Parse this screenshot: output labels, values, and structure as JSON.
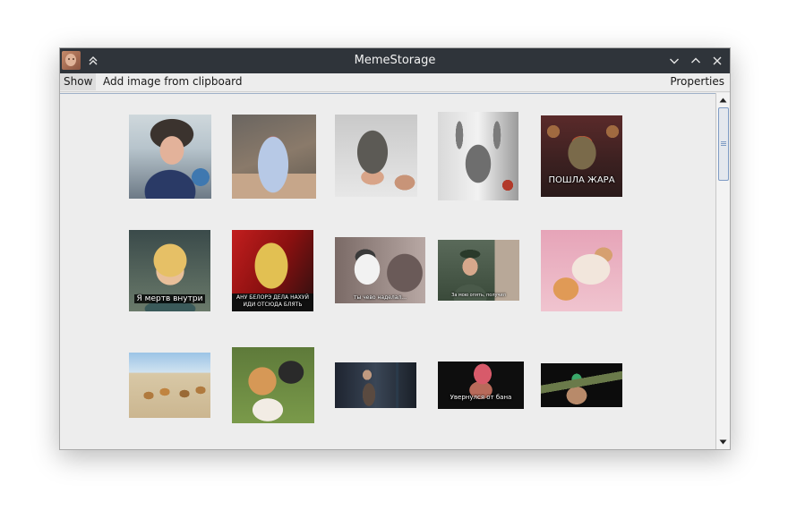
{
  "window": {
    "title": "MemeStorage",
    "icons": {
      "app": "app-avatar-icon",
      "keep_above": "double-chevron-up-icon",
      "minimize": "chevron-down-icon",
      "maximize": "chevron-up-icon",
      "close": "close-icon"
    }
  },
  "menu": {
    "show": "Show",
    "add_from_clipboard": "Add image from clipboard",
    "properties": "Properties"
  },
  "memes": {
    "row1": [
      {
        "name": "meme-boy-globe"
      },
      {
        "name": "meme-shark-costume"
      },
      {
        "name": "meme-wet-cat"
      },
      {
        "name": "meme-cat-arms-up"
      },
      {
        "name": "meme-armored-warrior",
        "caption": "ПОШЛА ЖАРА"
      }
    ],
    "row2": [
      {
        "name": "meme-blond-elf",
        "caption": "Я мертв внутри"
      },
      {
        "name": "meme-blood-elf",
        "caption_line1": "АНУ БЕЛОРЭ ДЕЛА НАХУЙ",
        "caption_line2": "ИДИ ОТСЮДА БЛЯТЬ"
      },
      {
        "name": "meme-cat-hedgehog",
        "caption": "ты чево наделал..."
      },
      {
        "name": "meme-officer",
        "caption": "За мою опять, получил"
      },
      {
        "name": "meme-cat-dog-cuddle"
      }
    ],
    "row3": [
      {
        "name": "meme-corgis-beach"
      },
      {
        "name": "meme-corgi-sunglasses"
      },
      {
        "name": "meme-dark-room-man"
      },
      {
        "name": "meme-returned-from-ban",
        "caption": "Увернулся от бана"
      },
      {
        "name": "meme-bazooka-man"
      }
    ]
  },
  "colors": {
    "titlebar": "#2f343a",
    "window_bg": "#ededed",
    "scroll_accent": "#7e9bc4"
  }
}
